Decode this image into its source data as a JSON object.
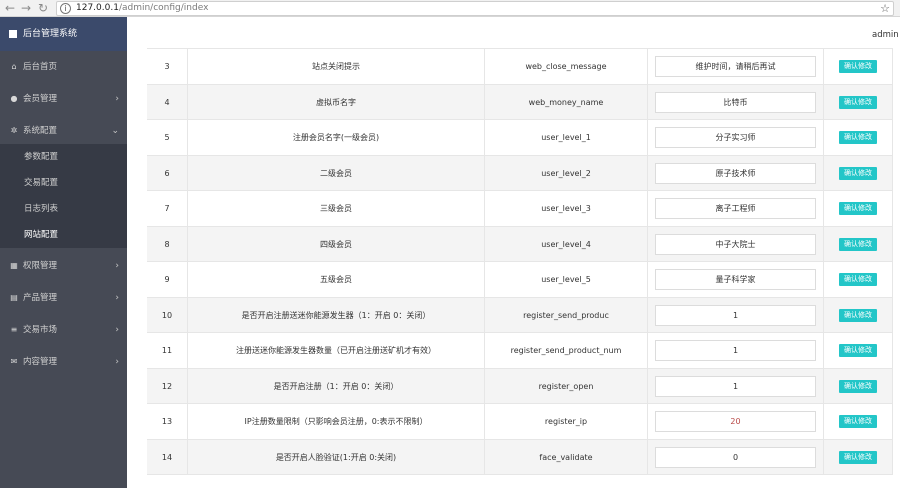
{
  "browser": {
    "url_host": "127.0.0.1",
    "url_path": "/admin/config/index",
    "back_icon": "arrow-left-icon",
    "forward_icon": "arrow-right-icon",
    "reload_icon": "reload-icon",
    "bookmark_icon": "star-icon"
  },
  "header": {
    "user": "admin"
  },
  "sidebar": {
    "brand": "后台管理系统",
    "items": [
      {
        "label": "后台首页",
        "icon": "home-icon"
      },
      {
        "label": "会员管理",
        "icon": "user-icon"
      },
      {
        "label": "系统配置",
        "icon": "gears-icon"
      },
      {
        "label": "权限管理",
        "icon": "grid-icon"
      },
      {
        "label": "产品管理",
        "icon": "list-icon"
      },
      {
        "label": "交易市场",
        "icon": "menu-icon"
      },
      {
        "label": "内容管理",
        "icon": "envelope-icon"
      }
    ],
    "submenu": [
      {
        "label": "参数配置"
      },
      {
        "label": "交易配置"
      },
      {
        "label": "日志列表"
      },
      {
        "label": "网站配置"
      }
    ]
  },
  "table": {
    "button_label": "确认修改",
    "rows": [
      {
        "id": "3",
        "name": "站点关闭提示",
        "key": "web_close_message",
        "value": "维护时间，请稍后再试"
      },
      {
        "id": "4",
        "name": "虚拟币名字",
        "key": "web_money_name",
        "value": "比特币"
      },
      {
        "id": "5",
        "name": "注册会员名字(一级会员)",
        "key": "user_level_1",
        "value": "分子实习师"
      },
      {
        "id": "6",
        "name": "二级会员",
        "key": "user_level_2",
        "value": "原子技术师"
      },
      {
        "id": "7",
        "name": "三级会员",
        "key": "user_level_3",
        "value": "离子工程师"
      },
      {
        "id": "8",
        "name": "四级会员",
        "key": "user_level_4",
        "value": "中子大院士"
      },
      {
        "id": "9",
        "name": "五级会员",
        "key": "user_level_5",
        "value": "量子科学家"
      },
      {
        "id": "10",
        "name": "是否开启注册送迷你能源发生器（1：开启 0：关闭）",
        "key": "register_send_produc",
        "value": "1"
      },
      {
        "id": "11",
        "name": "注册送迷你能源发生器数量（已开启注册送矿机才有效）",
        "key": "register_send_product_num",
        "value": "1"
      },
      {
        "id": "12",
        "name": "是否开启注册（1：开启 0：关闭）",
        "key": "register_open",
        "value": "1"
      },
      {
        "id": "13",
        "name": "IP注册数量限制（只影响会员注册，0:表示不限制）",
        "key": "register_ip",
        "value": "20"
      },
      {
        "id": "14",
        "name": "是否开启人脸验证(1:开启 0:关闭)",
        "key": "face_validate",
        "value": "0"
      }
    ]
  },
  "colors": {
    "sidebar_bg": "#464a55",
    "brand_bg": "#3b4a6b",
    "submenu_bg": "#363a45",
    "button_bg": "#23c6c8"
  }
}
